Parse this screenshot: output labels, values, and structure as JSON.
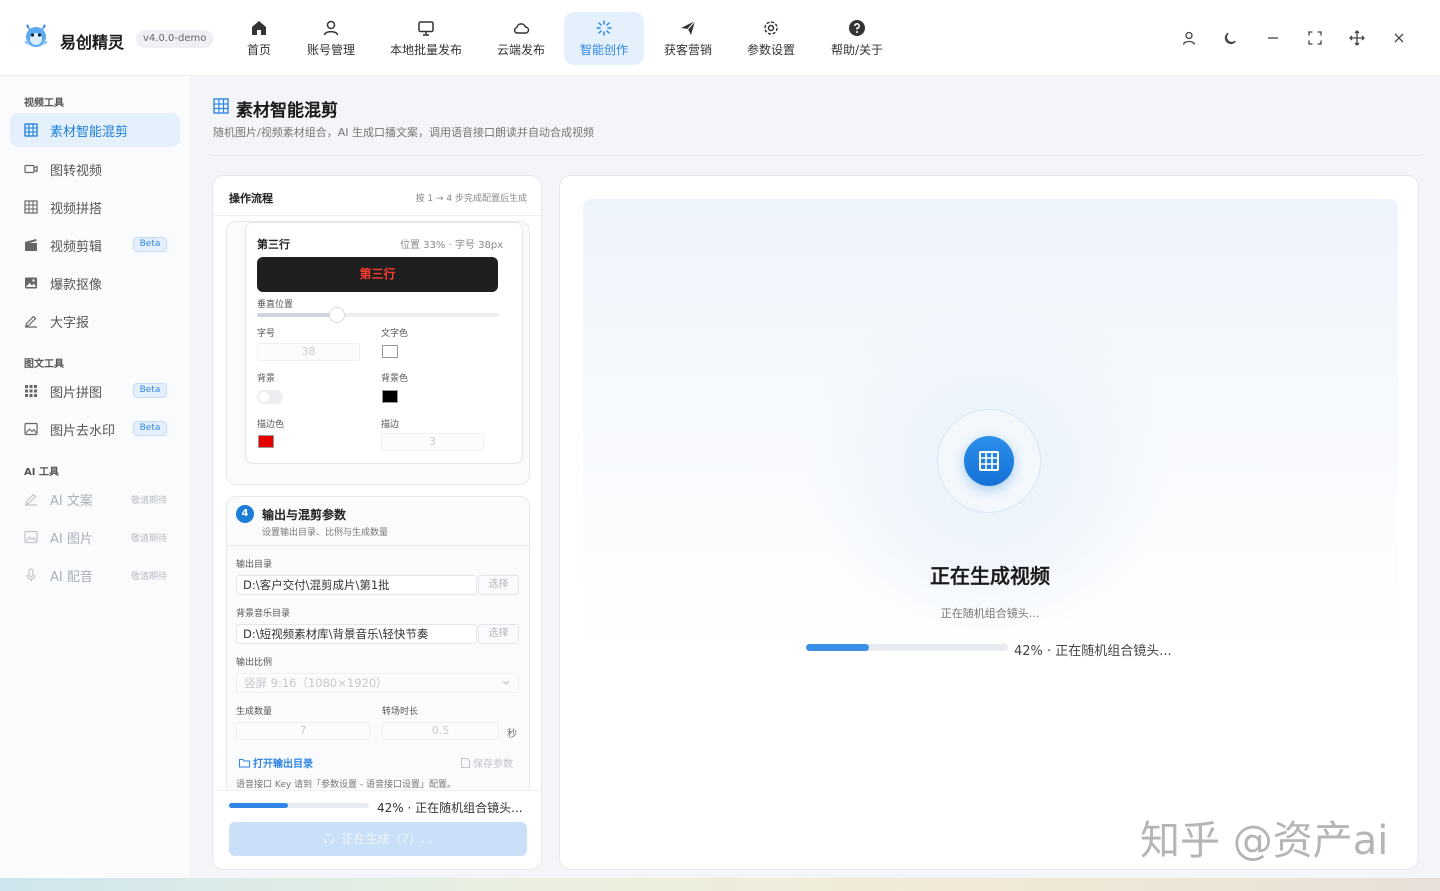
{
  "app": {
    "name": "易创精灵",
    "version": "v4.0.0-demo"
  },
  "nav": [
    {
      "label": "首页",
      "icon": "home-icon"
    },
    {
      "label": "账号管理",
      "icon": "user-icon"
    },
    {
      "label": "本地批量发布",
      "icon": "monitor-icon"
    },
    {
      "label": "云端发布",
      "icon": "cloud-icon"
    },
    {
      "label": "智能创作",
      "icon": "sparkle-icon",
      "active": true
    },
    {
      "label": "获客营销",
      "icon": "send-icon"
    },
    {
      "label": "参数设置",
      "icon": "gear-icon"
    },
    {
      "label": "帮助/关于",
      "icon": "help-icon"
    }
  ],
  "window_controls": [
    "user-icon",
    "moon-icon",
    "minimize-icon",
    "fullscreen-icon",
    "move-icon",
    "close-icon"
  ],
  "sidebar": {
    "groups": [
      {
        "title": "视频工具",
        "items": [
          {
            "label": "素材智能混剪",
            "icon": "grid-icon",
            "active": true
          },
          {
            "label": "图转视频",
            "icon": "video-icon"
          },
          {
            "label": "视频拼搭",
            "icon": "grid-icon"
          },
          {
            "label": "视频剪辑",
            "icon": "clapper-icon",
            "badge": "Beta"
          },
          {
            "label": "爆款抠像",
            "icon": "image-icon"
          },
          {
            "label": "大字报",
            "icon": "pen-icon"
          }
        ]
      },
      {
        "title": "图文工具",
        "items": [
          {
            "label": "图片拼图",
            "icon": "dots-grid-icon",
            "badge": "Beta"
          },
          {
            "label": "图片去水印",
            "icon": "image-icon",
            "badge": "Beta"
          }
        ]
      },
      {
        "title": "AI 工具",
        "items": [
          {
            "label": "AI 文案",
            "icon": "pen-icon",
            "note": "敬请期待"
          },
          {
            "label": "AI 图片",
            "icon": "image-icon",
            "note": "敬请期待"
          },
          {
            "label": "AI 配音",
            "icon": "mic-icon",
            "note": "敬请期待"
          }
        ]
      }
    ]
  },
  "page": {
    "title": "素材智能混剪",
    "subtitle": "随机图片/视频素材组合，AI 生成口播文案，调用语音接口朗读并自动合成视频"
  },
  "flow": {
    "title": "操作流程",
    "hint": "按 1 → 4 步完成配置后生成",
    "row3": {
      "title": "第三行",
      "meta": "位置 33% · 字号 38px",
      "preview": "第三行",
      "vpos_label": "垂直位置",
      "vpos_value": 0.33,
      "size_label": "字号",
      "size_value": "38",
      "text_color_label": "文字色",
      "text_color": "#ffffff",
      "bg_label": "背景",
      "bg_on": false,
      "bg_color_label": "背景色",
      "bg_color": "#000000",
      "stroke_color_label": "描边色",
      "stroke_color": "#e60000",
      "stroke_label": "描边",
      "stroke_value": "3"
    },
    "step4": {
      "num": "4",
      "title": "输出与混剪参数",
      "subtitle": "设置输出目录、比例与生成数量",
      "out_dir_label": "输出目录",
      "out_dir": "D:\\客户交付\\混剪成片\\第1批",
      "music_dir_label": "背景音乐目录",
      "music_dir": "D:\\短视频素材库\\背景音乐\\轻快节奏",
      "pick": "选择",
      "ratio_label": "输出比例",
      "ratio": "竖屏 9:16（1080×1920）",
      "count_label": "生成数量",
      "count": "7",
      "trans_label": "转场时长",
      "trans": "0.5",
      "sec": "秒",
      "open_dir": "打开输出目录",
      "save_params": "保存参数",
      "note": "语音接口 Key 请到「参数设置 - 语音接口设置」配置。"
    },
    "progress": {
      "value": 0.42,
      "text": "42% · 正在随机组合镜头..."
    },
    "generate_btn": "正在生成（7）..."
  },
  "preview": {
    "title": "正在生成视频",
    "status": "正在随机组合镜头...",
    "progress_value": 0.42,
    "progress_text": "42% · 正在随机组合镜头..."
  },
  "watermark": "知乎 @资产ai",
  "colors": {
    "accent": "#1c7ed6",
    "active_bg": "#e4f0fc",
    "preview_text": "#ff3b30"
  }
}
